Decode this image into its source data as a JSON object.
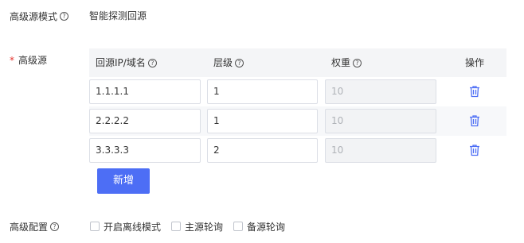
{
  "mode": {
    "label": "高级源模式",
    "value": "智能探测回源"
  },
  "origin": {
    "required_mark": "*",
    "label": "高级源",
    "columns": {
      "address": "回源IP/域名",
      "level": "层级",
      "weight": "权重",
      "actions": "操作"
    },
    "rows": [
      {
        "address": "1.1.1.1",
        "level": "1",
        "weight": "10"
      },
      {
        "address": "2.2.2.2",
        "level": "1",
        "weight": "10"
      },
      {
        "address": "3.3.3.3",
        "level": "2",
        "weight": "10"
      }
    ],
    "add_label": "新增"
  },
  "config": {
    "label": "高级配置",
    "options": [
      {
        "label": "开启离线模式",
        "checked": false
      },
      {
        "label": "主源轮询",
        "checked": false
      },
      {
        "label": "备源轮询",
        "checked": false
      }
    ]
  },
  "colors": {
    "primary": "#4d6ef5",
    "required": "#e5322d",
    "trash": "#4d6ef5"
  },
  "icons": {
    "help": "question-circle-icon",
    "delete": "trash-icon"
  }
}
